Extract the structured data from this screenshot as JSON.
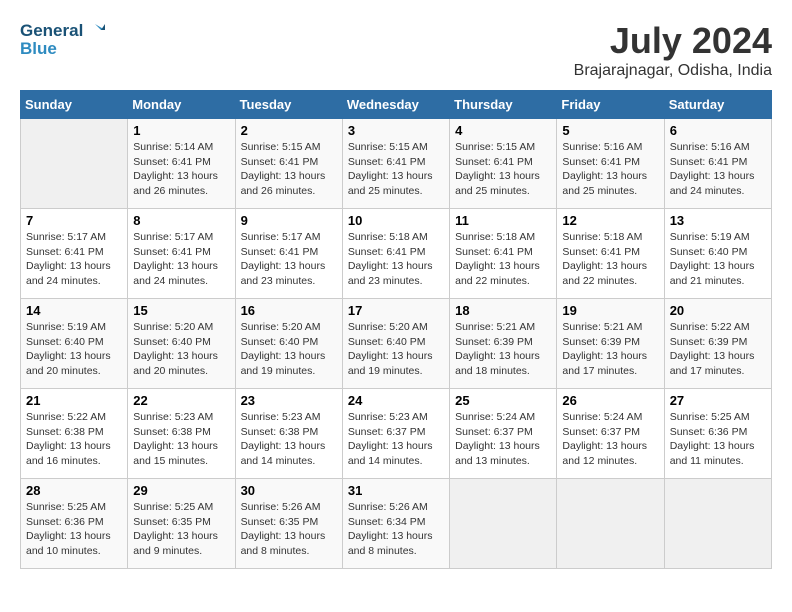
{
  "header": {
    "logo_line1": "General",
    "logo_line2": "Blue",
    "month": "July 2024",
    "location": "Brajarajnagar, Odisha, India"
  },
  "weekdays": [
    "Sunday",
    "Monday",
    "Tuesday",
    "Wednesday",
    "Thursday",
    "Friday",
    "Saturday"
  ],
  "weeks": [
    [
      {
        "day": "",
        "info": ""
      },
      {
        "day": "1",
        "info": "Sunrise: 5:14 AM\nSunset: 6:41 PM\nDaylight: 13 hours\nand 26 minutes."
      },
      {
        "day": "2",
        "info": "Sunrise: 5:15 AM\nSunset: 6:41 PM\nDaylight: 13 hours\nand 26 minutes."
      },
      {
        "day": "3",
        "info": "Sunrise: 5:15 AM\nSunset: 6:41 PM\nDaylight: 13 hours\nand 25 minutes."
      },
      {
        "day": "4",
        "info": "Sunrise: 5:15 AM\nSunset: 6:41 PM\nDaylight: 13 hours\nand 25 minutes."
      },
      {
        "day": "5",
        "info": "Sunrise: 5:16 AM\nSunset: 6:41 PM\nDaylight: 13 hours\nand 25 minutes."
      },
      {
        "day": "6",
        "info": "Sunrise: 5:16 AM\nSunset: 6:41 PM\nDaylight: 13 hours\nand 24 minutes."
      }
    ],
    [
      {
        "day": "7",
        "info": "Sunrise: 5:17 AM\nSunset: 6:41 PM\nDaylight: 13 hours\nand 24 minutes."
      },
      {
        "day": "8",
        "info": "Sunrise: 5:17 AM\nSunset: 6:41 PM\nDaylight: 13 hours\nand 24 minutes."
      },
      {
        "day": "9",
        "info": "Sunrise: 5:17 AM\nSunset: 6:41 PM\nDaylight: 13 hours\nand 23 minutes."
      },
      {
        "day": "10",
        "info": "Sunrise: 5:18 AM\nSunset: 6:41 PM\nDaylight: 13 hours\nand 23 minutes."
      },
      {
        "day": "11",
        "info": "Sunrise: 5:18 AM\nSunset: 6:41 PM\nDaylight: 13 hours\nand 22 minutes."
      },
      {
        "day": "12",
        "info": "Sunrise: 5:18 AM\nSunset: 6:41 PM\nDaylight: 13 hours\nand 22 minutes."
      },
      {
        "day": "13",
        "info": "Sunrise: 5:19 AM\nSunset: 6:40 PM\nDaylight: 13 hours\nand 21 minutes."
      }
    ],
    [
      {
        "day": "14",
        "info": "Sunrise: 5:19 AM\nSunset: 6:40 PM\nDaylight: 13 hours\nand 20 minutes."
      },
      {
        "day": "15",
        "info": "Sunrise: 5:20 AM\nSunset: 6:40 PM\nDaylight: 13 hours\nand 20 minutes."
      },
      {
        "day": "16",
        "info": "Sunrise: 5:20 AM\nSunset: 6:40 PM\nDaylight: 13 hours\nand 19 minutes."
      },
      {
        "day": "17",
        "info": "Sunrise: 5:20 AM\nSunset: 6:40 PM\nDaylight: 13 hours\nand 19 minutes."
      },
      {
        "day": "18",
        "info": "Sunrise: 5:21 AM\nSunset: 6:39 PM\nDaylight: 13 hours\nand 18 minutes."
      },
      {
        "day": "19",
        "info": "Sunrise: 5:21 AM\nSunset: 6:39 PM\nDaylight: 13 hours\nand 17 minutes."
      },
      {
        "day": "20",
        "info": "Sunrise: 5:22 AM\nSunset: 6:39 PM\nDaylight: 13 hours\nand 17 minutes."
      }
    ],
    [
      {
        "day": "21",
        "info": "Sunrise: 5:22 AM\nSunset: 6:38 PM\nDaylight: 13 hours\nand 16 minutes."
      },
      {
        "day": "22",
        "info": "Sunrise: 5:23 AM\nSunset: 6:38 PM\nDaylight: 13 hours\nand 15 minutes."
      },
      {
        "day": "23",
        "info": "Sunrise: 5:23 AM\nSunset: 6:38 PM\nDaylight: 13 hours\nand 14 minutes."
      },
      {
        "day": "24",
        "info": "Sunrise: 5:23 AM\nSunset: 6:37 PM\nDaylight: 13 hours\nand 14 minutes."
      },
      {
        "day": "25",
        "info": "Sunrise: 5:24 AM\nSunset: 6:37 PM\nDaylight: 13 hours\nand 13 minutes."
      },
      {
        "day": "26",
        "info": "Sunrise: 5:24 AM\nSunset: 6:37 PM\nDaylight: 13 hours\nand 12 minutes."
      },
      {
        "day": "27",
        "info": "Sunrise: 5:25 AM\nSunset: 6:36 PM\nDaylight: 13 hours\nand 11 minutes."
      }
    ],
    [
      {
        "day": "28",
        "info": "Sunrise: 5:25 AM\nSunset: 6:36 PM\nDaylight: 13 hours\nand 10 minutes."
      },
      {
        "day": "29",
        "info": "Sunrise: 5:25 AM\nSunset: 6:35 PM\nDaylight: 13 hours\nand 9 minutes."
      },
      {
        "day": "30",
        "info": "Sunrise: 5:26 AM\nSunset: 6:35 PM\nDaylight: 13 hours\nand 8 minutes."
      },
      {
        "day": "31",
        "info": "Sunrise: 5:26 AM\nSunset: 6:34 PM\nDaylight: 13 hours\nand 8 minutes."
      },
      {
        "day": "",
        "info": ""
      },
      {
        "day": "",
        "info": ""
      },
      {
        "day": "",
        "info": ""
      }
    ]
  ]
}
